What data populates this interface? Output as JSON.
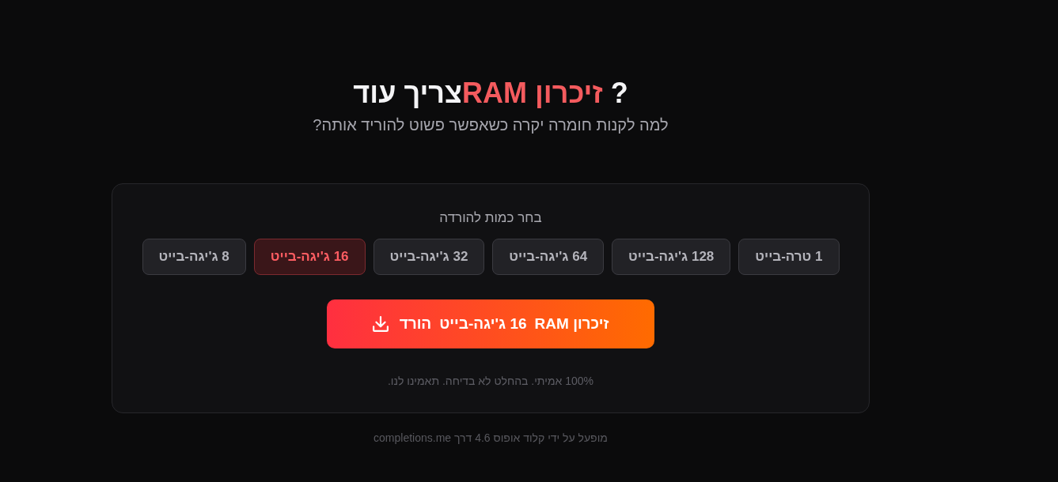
{
  "title": {
    "lead": "?",
    "highlight": "זיכרון RAM",
    "rest": "צריך עוד"
  },
  "subtitle": "למה לקנות חומרה יקרה כשאפשר פשוט להוריד אותה?",
  "panel": {
    "label": "בחר כמות להורדה",
    "size_options": [
      {
        "label": "1 טרה-בייט",
        "selected": false
      },
      {
        "label": "128 ג'יגה-בייט",
        "selected": false
      },
      {
        "label": "64 ג'יגה-בייט",
        "selected": false
      },
      {
        "label": "32 ג'יגה-בייט",
        "selected": false
      },
      {
        "label": "16 ג'יגה-בייט",
        "selected": true
      },
      {
        "label": "8 ג'יגה-בייט",
        "selected": false
      }
    ],
    "download_button": {
      "parts": [
        "זיכרון RAM",
        "16 ג'יגה-בייט",
        "הורד"
      ]
    },
    "note": "100% אמיתי. בהחלט לא בדיחה. תאמינו לנו."
  },
  "footer": "מופעל על ידי קלוד אופוס 4.6 דרך completions.me"
}
